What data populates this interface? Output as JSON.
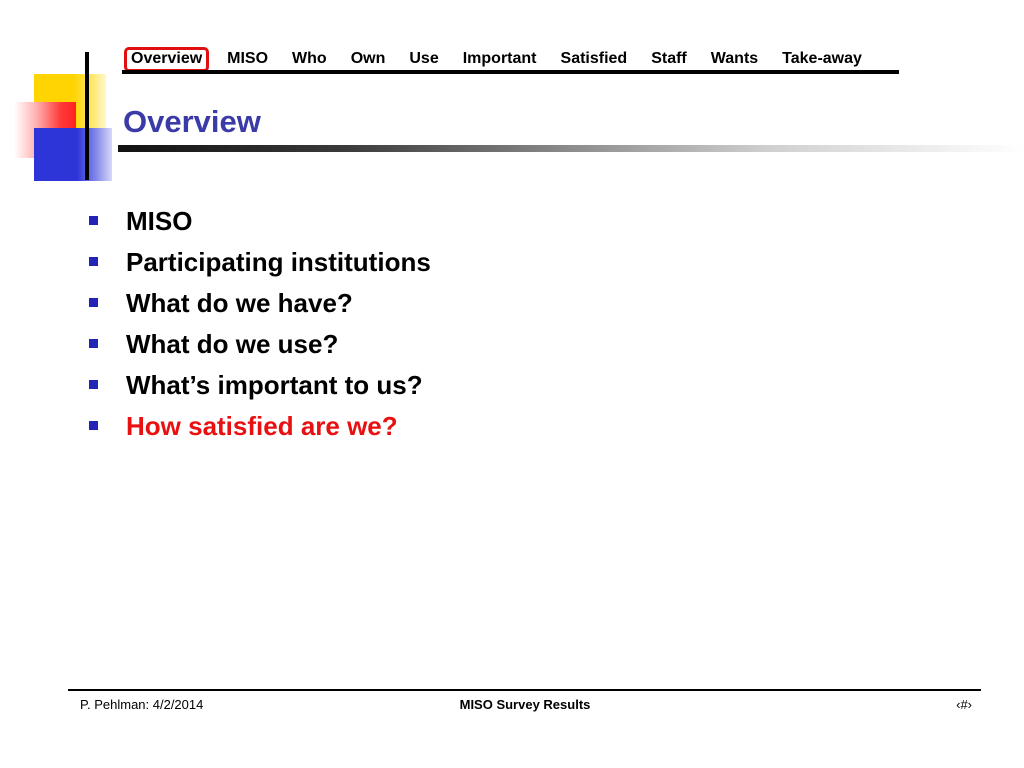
{
  "nav": {
    "items": [
      {
        "label": "Overview",
        "active": true
      },
      {
        "label": "MISO"
      },
      {
        "label": "Who"
      },
      {
        "label": "Own"
      },
      {
        "label": "Use"
      },
      {
        "label": "Important"
      },
      {
        "label": "Satisfied"
      },
      {
        "label": "Staff"
      },
      {
        "label": "Wants"
      },
      {
        "label": "Take-away"
      }
    ]
  },
  "slide": {
    "title": "Overview",
    "title_color": "#3a3aa8",
    "bullets": [
      {
        "text": "MISO"
      },
      {
        "text": "Participating institutions"
      },
      {
        "text": "What do we have?"
      },
      {
        "text": "What do we use?"
      },
      {
        "text": "What’s important to us?"
      },
      {
        "text": "How satisfied are we?",
        "highlight": true
      }
    ],
    "bullet_color": "#2323b8",
    "highlight_color": "#e81010"
  },
  "footer": {
    "left": "P. Pehlman: 4/2/2014",
    "center": "MISO Survey Results",
    "right": "‹#›"
  }
}
